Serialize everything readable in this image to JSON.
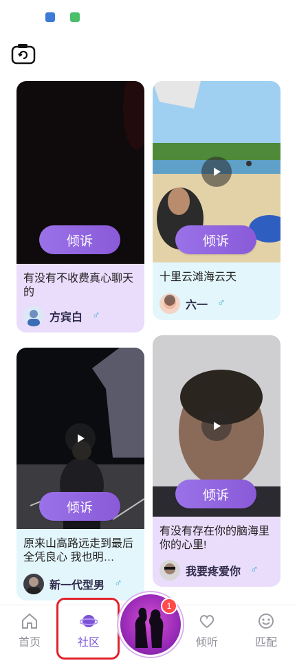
{
  "status_bar": {
    "icons": [
      "app-icon-1",
      "app-icon-2"
    ]
  },
  "header": {
    "camera_icon": "camera-switch-icon"
  },
  "posts": [
    {
      "title": "有没有不收费真心聊天的",
      "author": "方宾白",
      "gender": "♂",
      "action": "倾诉",
      "has_play": false
    },
    {
      "title": "十里云滩海云天",
      "author": "六一",
      "gender": "♂",
      "action": "倾诉",
      "has_play": true
    },
    {
      "title": "原来山高路远走到最后全凭良心 我也明…",
      "author": "新一代型男",
      "gender": "♂",
      "action": "倾诉",
      "has_play": true
    },
    {
      "title": "有没有存在你的脑海里你的心里!",
      "author": "我要疼爱你",
      "gender": "♂",
      "action": "倾诉",
      "has_play": true
    }
  ],
  "tabbar": {
    "items": [
      {
        "label": "首页",
        "icon": "home-icon"
      },
      {
        "label": "社区",
        "icon": "planet-icon",
        "active": true
      },
      {
        "label": "倾听",
        "icon": "heart-chat-icon"
      },
      {
        "label": "匹配",
        "icon": "smile-icon"
      }
    ],
    "center_badge": "1"
  },
  "colors": {
    "accent": "#7b52d6",
    "card_purple": "#eadcfb",
    "card_teal": "#e3f6fb"
  }
}
